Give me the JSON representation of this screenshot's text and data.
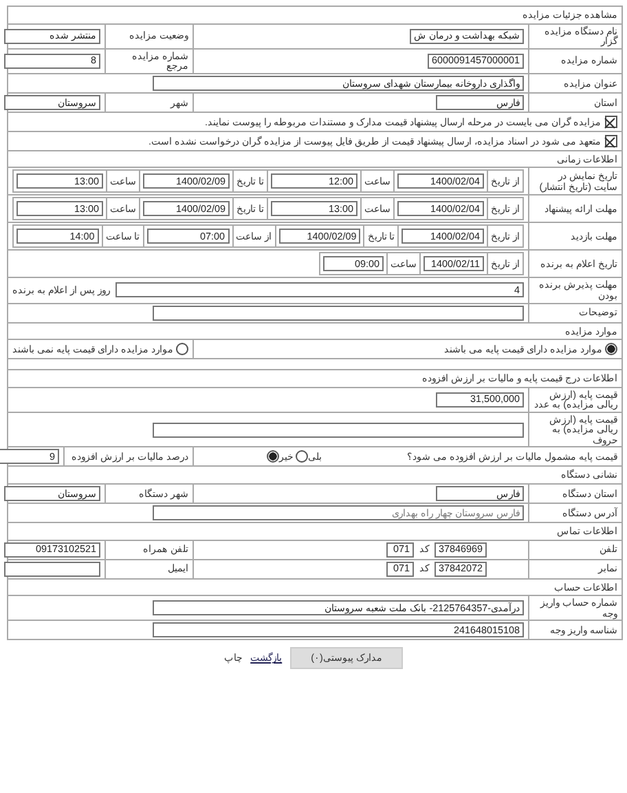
{
  "title": "مشاهده جزئیات مزایده",
  "rows": [
    {
      "kind": "pair",
      "label": "نام دستگاه مزایده گزار",
      "value": "شبکه بهداشت و درمان ش",
      "label_2": "وضعیت مزایده",
      "value_2": "منتشر شده"
    },
    {
      "kind": "pair",
      "label": "شماره مزایده",
      "value": "6000091457000001",
      "label_2": "شماره مزایده مرجع",
      "value_2": "8"
    },
    {
      "kind": "wide",
      "label": "عنوان مزایده",
      "value": "واگذاری داروخانه بیمارستان شهدای سروستان"
    },
    {
      "kind": "pair",
      "label": "استان",
      "value": "فارس",
      "label_2": "شهر",
      "value_2": "سروستان"
    },
    {
      "kind": "check",
      "text": "مزایده گران می بایست در مرحله ارسال پیشنهاد قیمت مدارک و مستندات مربوطه را پیوست نمایند.",
      "checked": true
    },
    {
      "kind": "check",
      "text": "متعهد می شود در اسناد مزایده، ارسال پیشنهاد قیمت از طریق فایل پیوست از مزایده گران درخواست نشده است.",
      "checked": true
    },
    {
      "kind": "heading",
      "text": "اطلاعات زمانی"
    },
    {
      "kind": "range",
      "label": "تاریخ نمایش در سایت (تاریخ انتشار)",
      "parts": [
        {
          "kind": "label",
          "text": "از تاریخ"
        },
        {
          "kind": "field",
          "value": "1400/02/04"
        },
        {
          "kind": "label",
          "text": "ساعت"
        },
        {
          "kind": "field",
          "value": "12:00"
        },
        {
          "kind": "label",
          "text": "تا تاریخ"
        },
        {
          "kind": "field",
          "value": "1400/02/09"
        },
        {
          "kind": "label",
          "text": "ساعت"
        },
        {
          "kind": "field",
          "value": "13:00"
        }
      ]
    },
    {
      "kind": "range",
      "label": "مهلت ارائه پیشنهاد",
      "parts": [
        {
          "kind": "label",
          "text": "از تاریخ"
        },
        {
          "kind": "field",
          "value": "1400/02/04"
        },
        {
          "kind": "label",
          "text": "ساعت"
        },
        {
          "kind": "field",
          "value": "13:00"
        },
        {
          "kind": "label",
          "text": "تا تاریخ"
        },
        {
          "kind": "field",
          "value": "1400/02/09"
        },
        {
          "kind": "label",
          "text": "ساعت"
        },
        {
          "kind": "field",
          "value": "13:00"
        }
      ]
    },
    {
      "kind": "range",
      "label": "مهلت بازدید",
      "parts": [
        {
          "kind": "label",
          "text": "از تاریخ"
        },
        {
          "kind": "field",
          "value": "1400/02/04"
        },
        {
          "kind": "label",
          "text": "تا تاریخ"
        },
        {
          "kind": "field",
          "value": "1400/02/09"
        },
        {
          "kind": "label",
          "text": "از ساعت"
        },
        {
          "kind": "field",
          "value": "07:00"
        },
        {
          "kind": "label",
          "text": "تا ساعت"
        },
        {
          "kind": "field",
          "value": "14:00"
        }
      ]
    },
    {
      "kind": "range",
      "label": "تاریخ اعلام به برنده",
      "parts": [
        {
          "kind": "label",
          "text": "از تاریخ"
        },
        {
          "kind": "field",
          "value": "1400/02/11"
        },
        {
          "kind": "label",
          "text": "ساعت"
        },
        {
          "kind": "field",
          "value": "09:00"
        }
      ]
    },
    {
      "kind": "inline",
      "label": "مهلت پذیرش برنده بودن",
      "value": "4",
      "text": "روز پس از اعلام به برنده"
    },
    {
      "kind": "wide",
      "label": "توضیحات"
    },
    {
      "kind": "heading",
      "text": "موارد مزایده"
    },
    {
      "kind": "radio",
      "options": [
        {
          "text": "موارد مزایده دارای قیمت پایه می باشند",
          "selected": true
        },
        {
          "text": "موارد مزایده دارای قیمت پایه نمی باشند",
          "selected": false
        }
      ]
    },
    {
      "kind": "blank"
    },
    {
      "kind": "heading",
      "text": "اطلاعات درج قیمت پایه و مالیات بر ارزش افزوده"
    },
    {
      "kind": "single",
      "label": "قیمت پایه (ارزش ریالی مزایده) به عدد",
      "value": "31,500,000"
    },
    {
      "kind": "wide",
      "label": "قیمت پایه (ارزش ریالی مزایده) به حروف"
    },
    {
      "kind": "vat",
      "question": "قیمت پایه مشمول مالیات بر ارزش افزوده می شود؟",
      "options": [
        {
          "text": "بلی",
          "selected": false
        },
        {
          "text": "خیر",
          "selected": true
        }
      ],
      "label_2": "درصد مالیات بر ارزش افزوده",
      "value_2": "9"
    },
    {
      "kind": "heading",
      "text": "نشانی دستگاه"
    },
    {
      "kind": "pair",
      "label": "استان دستگاه",
      "value": "فارس",
      "label_2": "شهر دستگاه",
      "value_2": "سروستان"
    },
    {
      "kind": "wide",
      "label": "آدرس دستگاه",
      "value": "فارس سروستان چهار راه بهداری",
      "disabled": true
    },
    {
      "kind": "heading",
      "text": "اطلاعات تماس"
    },
    {
      "kind": "phone",
      "label": "تلفن",
      "number": "37846969",
      "code_label": "کد",
      "code": "071",
      "label_2": "تلفن همراه",
      "value_2": "09173102521"
    },
    {
      "kind": "phone",
      "label": "نمابر",
      "number": "37842072",
      "code_label": "کد",
      "code": "071",
      "label_2": "ایمیل"
    },
    {
      "kind": "heading",
      "text": "اطلاعات حساب"
    },
    {
      "kind": "wide",
      "label": "شماره حساب واریز وجه",
      "value": "درآمدی-2125764357- بانک ملت شعبه سروستان"
    },
    {
      "kind": "wide",
      "label": "شناسه واریز وجه",
      "value": "241648015108"
    }
  ],
  "actions": [
    {
      "kind": "button",
      "text": "مدارک پیوستی(۰)"
    },
    {
      "kind": "link",
      "text": "بازگشت"
    },
    {
      "kind": "plain",
      "text": "چاپ"
    }
  ]
}
